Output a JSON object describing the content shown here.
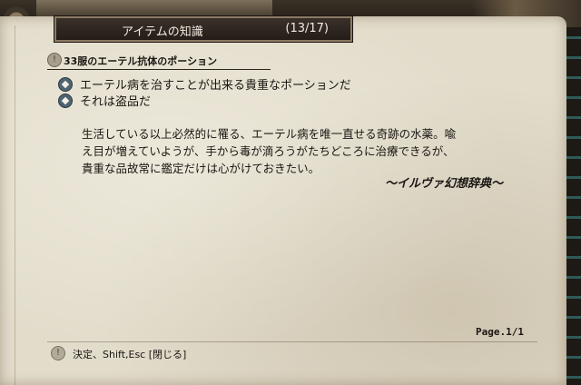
{
  "window": {
    "title": "アイテムの知識",
    "count": "(13/17)"
  },
  "item": {
    "heading": "33服のエーテル抗体のポーション",
    "properties": [
      "エーテル病を治すことが出来る貴重なポーションだ",
      "それは盗品だ"
    ],
    "description": [
      "生活している以上必然的に罹る、エーテル病を唯一直せる奇跡の水薬。喩",
      "え目が増えていようが、手から毒が滴ろうがたちどころに治療できるが、",
      "貴重な品故常に鑑定だけは心がけておきたい。"
    ],
    "source": "～イルヴァ幻想辞典～"
  },
  "page": "Page.1/1",
  "footer": {
    "hint": "決定、Shift,Esc [閉じる]"
  },
  "icons": {
    "heading": "info-icon",
    "property": "diamond-bullet-icon",
    "footer": "hint-icon"
  }
}
